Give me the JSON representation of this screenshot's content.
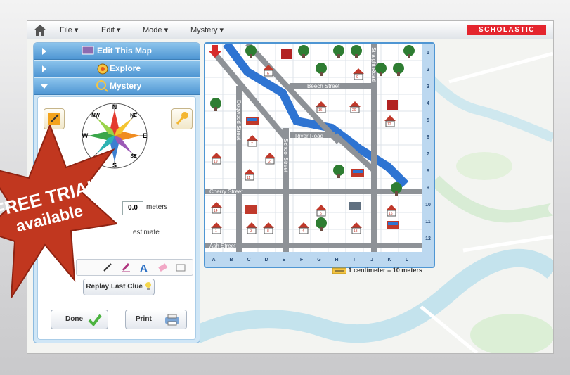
{
  "menubar": {
    "items": [
      "File",
      "Edit",
      "Mode",
      "Mystery"
    ],
    "brand": "SCHOLASTIC"
  },
  "panel": {
    "sections": [
      "Edit This Map",
      "Explore",
      "Mystery"
    ],
    "meters_value": "0.0",
    "meters_label": "meters",
    "estimate_label": "estimate",
    "replay_label": "Replay Last Clue",
    "done_label": "Done",
    "print_label": "Print"
  },
  "compass": {
    "N": "N",
    "NE": "NE",
    "E": "E",
    "SE": "SE",
    "S": "S",
    "NW": "NW",
    "W": "W"
  },
  "promo": {
    "line1": "FREE TRIAL",
    "line2": "available"
  },
  "map": {
    "columns": [
      "A",
      "B",
      "C",
      "D",
      "E",
      "F",
      "G",
      "H",
      "I",
      "J",
      "K",
      "L"
    ],
    "rows": [
      "1",
      "2",
      "3",
      "4",
      "5",
      "6",
      "7",
      "8",
      "9",
      "10",
      "11",
      "12"
    ],
    "streets": {
      "beech": "Beech Street",
      "river_road": "River Road",
      "cherry": "Cherry Street",
      "ash": "Ash Street",
      "dogwood": "Dogwood Street",
      "school": "School Street",
      "straight": "Straight Road"
    },
    "houses": [
      {
        "label": "6"
      },
      {
        "label": "9"
      },
      {
        "label": "11"
      },
      {
        "label": "16"
      },
      {
        "label": "20"
      },
      {
        "label": "7"
      },
      {
        "label": "2"
      },
      {
        "label": "11"
      },
      {
        "label": "19"
      },
      {
        "label": "14"
      },
      {
        "label": "1"
      },
      {
        "label": "3"
      },
      {
        "label": "8"
      },
      {
        "label": "5"
      },
      {
        "label": "15"
      },
      {
        "label": "13"
      },
      {
        "label": "4"
      },
      {
        "label": "12"
      }
    ],
    "scale_text": "1 centimeter = 10 meters"
  }
}
